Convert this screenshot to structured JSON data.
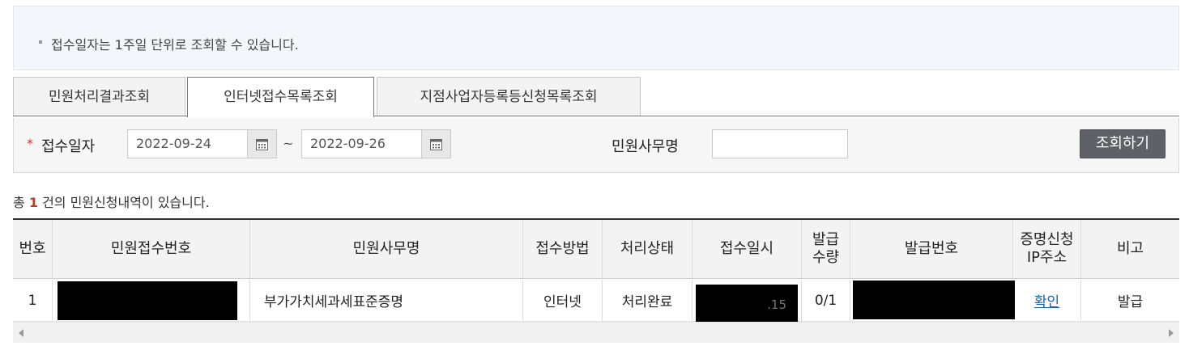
{
  "notice": {
    "text": "접수일자는 1주일 단위로 조회할 수 있습니다."
  },
  "tabs": [
    {
      "label": "민원처리결과조회",
      "active": false
    },
    {
      "label": "인터넷접수목록조회",
      "active": true
    },
    {
      "label": "지점사업자등록등신청목록조회",
      "active": false
    }
  ],
  "search": {
    "required_mark": "*",
    "date_label": "접수일자",
    "date_from": "2022-09-24",
    "date_to": "2022-09-26",
    "separator": "~",
    "name_label": "민원사무명",
    "name_value": "",
    "submit_label": "조회하기"
  },
  "summary": {
    "prefix": "총",
    "count": "1",
    "suffix": "건의 민원신청내역이 있습니다."
  },
  "table": {
    "headers": [
      "번호",
      "민원접수번호",
      "민원사무명",
      "접수방법",
      "처리상태",
      "접수일시",
      "발급\n수량",
      "발급번호",
      "증명신청\nIP주소",
      "비고"
    ],
    "rows": [
      {
        "no": "1",
        "receipt_no": "",
        "name": "부가가치세과세표준증명",
        "method": "인터넷",
        "status": "처리완료",
        "date_visible": ".15",
        "qty": "0/1",
        "issue_no": "",
        "ip_link": "확인",
        "note": "발급"
      }
    ]
  },
  "colors": {
    "accent_blue": "#5a7fa8",
    "count_red": "#c0392b",
    "button_gray": "#5e6167",
    "link_blue": "#1f5ea8"
  }
}
